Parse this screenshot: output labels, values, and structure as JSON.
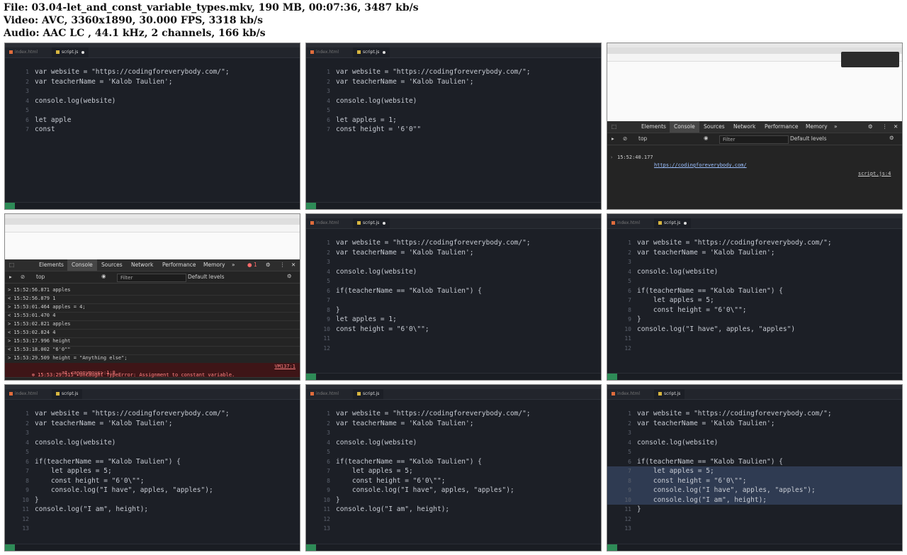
{
  "header": {
    "file_line": "File: 03.04-let_and_const_variable_types.mkv, 190 MB, 00:07:36, 3487 kb/s",
    "video_line": "Video: AVC, 3360x1890, 30.000 FPS, 3318 kb/s",
    "audio_line": "Audio: AAC LC , 44.1 kHz, 2 channels, 166 kb/s"
  },
  "editor": {
    "tab_inactive": "index.html",
    "tab_active": "script.js"
  },
  "thumb1": {
    "lines": [
      "var website = \"https://codingforeverybody.com/\";",
      "var teacherName = 'Kalob Taulien';",
      "",
      "console.log(website)",
      "",
      "let apple",
      "const"
    ]
  },
  "thumb2": {
    "lines": [
      "var website = \"https://codingforeverybody.com/\";",
      "var teacherName = 'Kalob Taulien';",
      "",
      "console.log(website)",
      "",
      "let apples = 1;",
      "const height = '6'0\"\""
    ]
  },
  "thumb3": {
    "tabs": [
      "Elements",
      "Console",
      "Sources",
      "Network",
      "Performance",
      "Memory"
    ],
    "context": "top",
    "filter": "Filter",
    "levels": "Default levels",
    "logs": [
      {
        "time": "15:52:40.177",
        "text": "https://codingforeverybody.com/",
        "src": "script.js:4"
      }
    ]
  },
  "thumb4": {
    "tabs": [
      "Elements",
      "Console",
      "Sources",
      "Network",
      "Performance",
      "Memory"
    ],
    "context": "top",
    "filter": "Filter",
    "levels": "Default levels",
    "error_count": "1",
    "logs": [
      "> 15:52:56.871 apples",
      "< 15:52:56.879 1",
      "> 15:53:01.464 apples = 4;",
      "< 15:53:01.470 4",
      "> 15:53:02.821 apples",
      "< 15:53:02.824 4",
      "> 15:53:17.996 height",
      "< 15:53:18.002 \"6'0\"\"",
      "> 15:53:29.509 height = \"Anything else\";"
    ],
    "error": "15:53:29.515 ▸Uncaught TypeError: Assignment to constant variable.",
    "error_sub": "at <anonymous>:1:8",
    "error_src": "VM137:1"
  },
  "thumb5": {
    "lines": [
      "var website = \"https://codingforeverybody.com/\";",
      "var teacherName = 'Kalob Taulien';",
      "",
      "console.log(website)",
      "",
      "if(teacherName == \"Kalob Taulien\") {",
      "",
      "}",
      "let apples = 1;",
      "const height = \"6'0\\\"\";",
      "",
      ""
    ]
  },
  "thumb6": {
    "lines": [
      "var website = \"https://codingforeverybody.com/\";",
      "var teacherName = 'Kalob Taulien';",
      "",
      "console.log(website)",
      "",
      "if(teacherName == \"Kalob Taulien\") {",
      "    let apples = 5;",
      "    const height = \"6'0\\\"\";",
      "}",
      "console.log(\"I have\", apples, \"apples\")",
      "",
      ""
    ]
  },
  "thumb7": {
    "lines": [
      "var website = \"https://codingforeverybody.com/\";",
      "var teacherName = 'Kalob Taulien';",
      "",
      "console.log(website)",
      "",
      "if(teacherName == \"Kalob Taulien\") {",
      "    let apples = 5;",
      "    const height = \"6'0\\\"\";",
      "    console.log(\"I have\", apples, \"apples\");",
      "}",
      "console.log(\"I am\", height);",
      "",
      ""
    ]
  },
  "thumb8": {
    "lines": [
      "var website = \"https://codingforeverybody.com/\";",
      "var teacherName = 'Kalob Taulien';",
      "",
      "console.log(website)",
      "",
      "if(teacherName == \"Kalob Taulien\") {",
      "    let apples = 5;",
      "    const height = \"6'0\\\"\";",
      "    console.log(\"I have\", apples, \"apples\");",
      "}",
      "console.log(\"I am\", height);",
      "",
      ""
    ]
  },
  "thumb9": {
    "lines": [
      "var website = \"https://codingforeverybody.com/\";",
      "var teacherName = 'Kalob Taulien';",
      "",
      "console.log(website)",
      "",
      "if(teacherName == \"Kalob Taulien\") {",
      "    let apples = 5;",
      "    const height = \"6'0\\\"\";",
      "    console.log(\"I have\", apples, \"apples\");",
      "    console.log(\"I am\", height);",
      "}",
      "",
      ""
    ]
  }
}
